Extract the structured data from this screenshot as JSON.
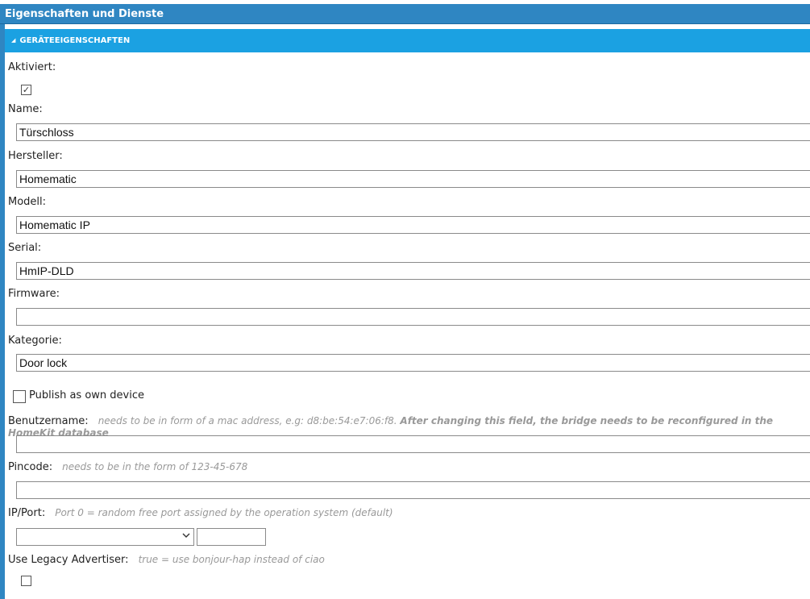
{
  "window": {
    "title": "Eigenschaften und Dienste"
  },
  "section": {
    "title": "GERÄTEEIGENSCHAFTEN",
    "toggle_glyph": "◢"
  },
  "fields": {
    "activated": {
      "label": "Aktiviert:",
      "checked": true,
      "check_glyph": "✓"
    },
    "name": {
      "label": "Name:",
      "value": "Türschloss"
    },
    "manufacturer": {
      "label": "Hersteller:",
      "value": "Homematic"
    },
    "model": {
      "label": "Modell:",
      "value": "Homematic IP"
    },
    "serial": {
      "label": "Serial:",
      "value": "HmIP-DLD"
    },
    "firmware": {
      "label": "Firmware:",
      "value": ""
    },
    "category": {
      "label": "Kategorie:",
      "value": "Door lock"
    },
    "publish_own": {
      "label": "Publish as own device",
      "checked": false
    },
    "username": {
      "label": "Benutzername:",
      "hint": "needs to be in form of a mac address, e.g: d8:be:54:e7:06:f8.",
      "hint_bold": "After changing this field, the bridge needs to be reconfigured in the HomeKit database",
      "value": ""
    },
    "pincode": {
      "label": "Pincode:",
      "hint": "needs to be in the form of 123-45-678",
      "value": ""
    },
    "ip_port": {
      "label": "IP/Port:",
      "hint": "Port 0 = random free port assigned by the operation system (default)",
      "ip_value": "",
      "port_value": ""
    },
    "legacy_advertiser": {
      "label": "Use Legacy Advertiser:",
      "hint": "true = use bonjour-hap instead of ciao",
      "checked": false
    }
  },
  "colors": {
    "titlebar": "#2f86c2",
    "section": "#1ba1e2",
    "hint": "#999999"
  }
}
